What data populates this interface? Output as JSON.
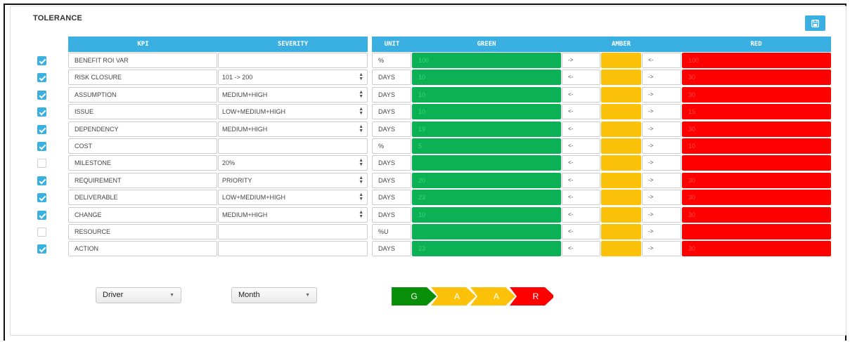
{
  "title": "TOLERANCE",
  "save_button_icon": "save-icon",
  "headers": {
    "kpi": "KPI",
    "severity": "SEVERITY",
    "unit": "UNIT",
    "green": "GREEN",
    "amber": "AMBER",
    "red": "RED"
  },
  "colors": {
    "header": "#3ab0e2",
    "green": "#0bb154",
    "amber": "#fcc20a",
    "red": "#fe0000"
  },
  "rows": [
    {
      "checked": true,
      "kpi": "BENEFIT ROI VAR",
      "severity": "",
      "severity_select": false,
      "unit": "%",
      "green": "100",
      "arrow1": "->",
      "amber": "",
      "arrow2": "<-",
      "red": "100"
    },
    {
      "checked": true,
      "kpi": "RISK CLOSURE",
      "severity": "101 -> 200",
      "severity_select": true,
      "unit": "DAYS",
      "green": "10",
      "arrow1": "<-",
      "amber": "",
      "arrow2": "->",
      "red": "30"
    },
    {
      "checked": true,
      "kpi": "ASSUMPTION",
      "severity": "MEDIUM+HIGH",
      "severity_select": true,
      "unit": "DAYS",
      "green": "10",
      "arrow1": "<-",
      "amber": "",
      "arrow2": "->",
      "red": "30"
    },
    {
      "checked": true,
      "kpi": "ISSUE",
      "severity": "LOW+MEDIUM+HIGH",
      "severity_select": true,
      "unit": "DAYS",
      "green": "10",
      "arrow1": "<-",
      "amber": "",
      "arrow2": "->",
      "red": "15"
    },
    {
      "checked": true,
      "kpi": "DEPENDENCY",
      "severity": "MEDIUM+HIGH",
      "severity_select": true,
      "unit": "DAYS",
      "green": "19",
      "arrow1": "<-",
      "amber": "",
      "arrow2": "->",
      "red": "30"
    },
    {
      "checked": true,
      "kpi": "COST",
      "severity": "",
      "severity_select": false,
      "unit": "%",
      "green": "5",
      "arrow1": "<-",
      "amber": "",
      "arrow2": "->",
      "red": "10"
    },
    {
      "checked": false,
      "kpi": "MILESTONE",
      "severity": "20%",
      "severity_select": true,
      "unit": "DAYS",
      "green": "",
      "arrow1": "<-",
      "amber": "",
      "arrow2": "->",
      "red": ""
    },
    {
      "checked": true,
      "kpi": "REQUIREMENT",
      "severity": "PRIORITY",
      "severity_select": true,
      "unit": "DAYS",
      "green": "20",
      "arrow1": "<-",
      "amber": "",
      "arrow2": "->",
      "red": "30"
    },
    {
      "checked": true,
      "kpi": "DELIVERABLE",
      "severity": "LOW+MEDIUM+HIGH",
      "severity_select": true,
      "unit": "DAYS",
      "green": "23",
      "arrow1": "<-",
      "amber": "",
      "arrow2": "->",
      "red": "30"
    },
    {
      "checked": true,
      "kpi": "CHANGE",
      "severity": "MEDIUM+HIGH",
      "severity_select": true,
      "unit": "DAYS",
      "green": "10",
      "arrow1": "<-",
      "amber": "",
      "arrow2": "->",
      "red": "30"
    },
    {
      "checked": false,
      "kpi": "RESOURCE",
      "severity": "",
      "severity_select": false,
      "unit": "%U",
      "green": "",
      "arrow1": "<-",
      "amber": "",
      "arrow2": "->",
      "red": ""
    },
    {
      "checked": true,
      "kpi": "ACTION",
      "severity": "",
      "severity_select": false,
      "unit": "DAYS",
      "green": "23",
      "arrow1": "<-",
      "amber": "",
      "arrow2": "->",
      "red": "30"
    }
  ],
  "filters": {
    "driver": {
      "value": "Driver"
    },
    "period": {
      "value": "Month"
    }
  },
  "legend": [
    {
      "label": "G",
      "color": "#0a8f0a"
    },
    {
      "label": "A",
      "color": "#fcc20a"
    },
    {
      "label": "A",
      "color": "#fcc20a"
    },
    {
      "label": "R",
      "color": "#fe0000"
    }
  ]
}
